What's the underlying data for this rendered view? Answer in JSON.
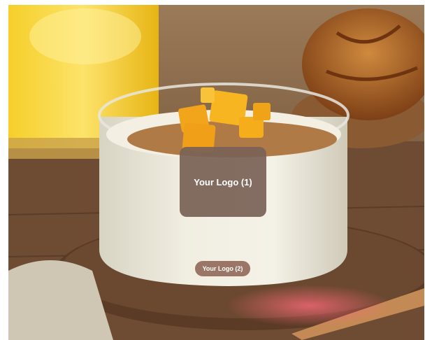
{
  "photo": {
    "subject": "mango-granola-yogurt-bowl",
    "colors": {
      "table": "#6e4c33",
      "board": "#5b3b26",
      "juice": "#f0c21a",
      "yogurt": "#ece8d9",
      "mango": "#f2a51a",
      "granola": "#b07a46",
      "bread": "#b36a2a"
    }
  },
  "logos": [
    {
      "label": "Your Logo (1)",
      "color": "#7a6256"
    },
    {
      "label": "Your Logo (2)",
      "color": "#966e5f"
    }
  ]
}
